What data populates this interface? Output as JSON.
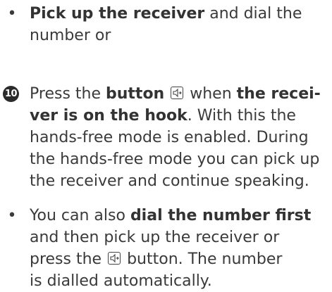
{
  "block1": {
    "marker": "•",
    "line1_bold": "Pick up the receiver",
    "line1_rest": " and dial the",
    "line2": "number or"
  },
  "block2": {
    "step_number": "10",
    "line1_a": "Press the ",
    "line1_bold_a": "button",
    "line1_b": " when ",
    "line1_bold_b": "the recei-",
    "line2_bold": "ver is on the hook",
    "line2_rest": ". With this the",
    "line3": "hands-free mode is enabled. During",
    "line4": "the hands-free mode you can pick up",
    "line5": "the receiver and continue speaking."
  },
  "block3": {
    "marker": "•",
    "line1_a": "You can also ",
    "line1_bold": "dial the number first",
    "line2": "and then pick up the receiver or",
    "line3_a": "press the ",
    "line3_b": " button. The number",
    "line4": "is dialled automatically."
  },
  "icons": {
    "speaker_button": "speaker-button-icon"
  }
}
